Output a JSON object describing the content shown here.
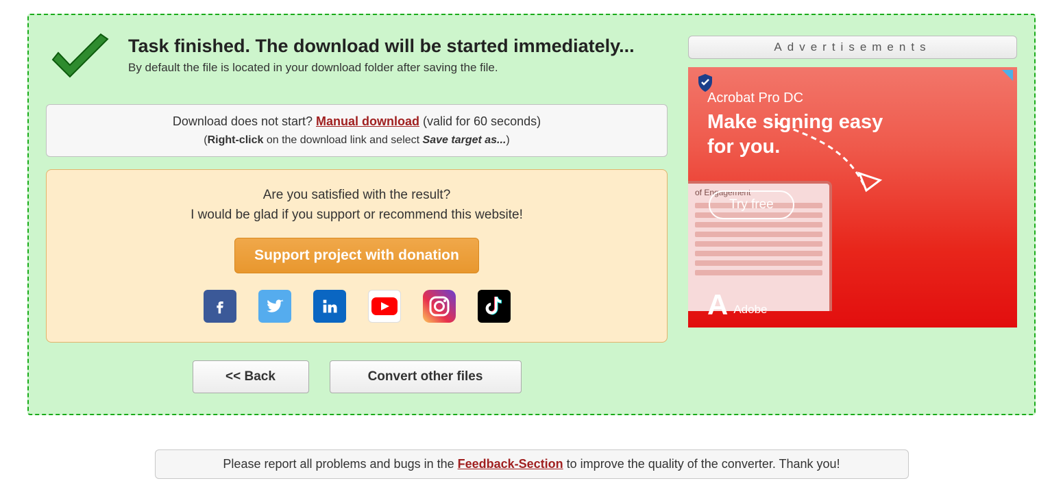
{
  "header": {
    "title": "Task finished. The download will be started immediately...",
    "subtitle": "By default the file is located in your download folder after saving the file."
  },
  "download_box": {
    "prefix": "Download does not start? ",
    "link": "Manual download",
    "suffix": " (valid for 60 seconds)",
    "hint_open": "(",
    "hint_bold": "Right-click",
    "hint_mid": " on the download link and select ",
    "hint_italic": "Save target as...",
    "hint_close": ")"
  },
  "support_box": {
    "line1": "Are you satisfied with the result?",
    "line2": "I would be glad if you support or recommend this website!",
    "button": "Support project with donation"
  },
  "nav": {
    "back": "<< Back",
    "convert": "Convert other files"
  },
  "ads": {
    "header": "Advertisements",
    "product": "Acrobat Pro DC",
    "tagline1": "Make signing easy",
    "tagline2": "for you.",
    "cta": "Try free",
    "brand": "Adobe",
    "doc_title": "of Engagement"
  },
  "footer": {
    "prefix": "Please report all problems and bugs in the ",
    "link": "Feedback-Section",
    "suffix": " to improve the quality of the converter. Thank you!"
  }
}
